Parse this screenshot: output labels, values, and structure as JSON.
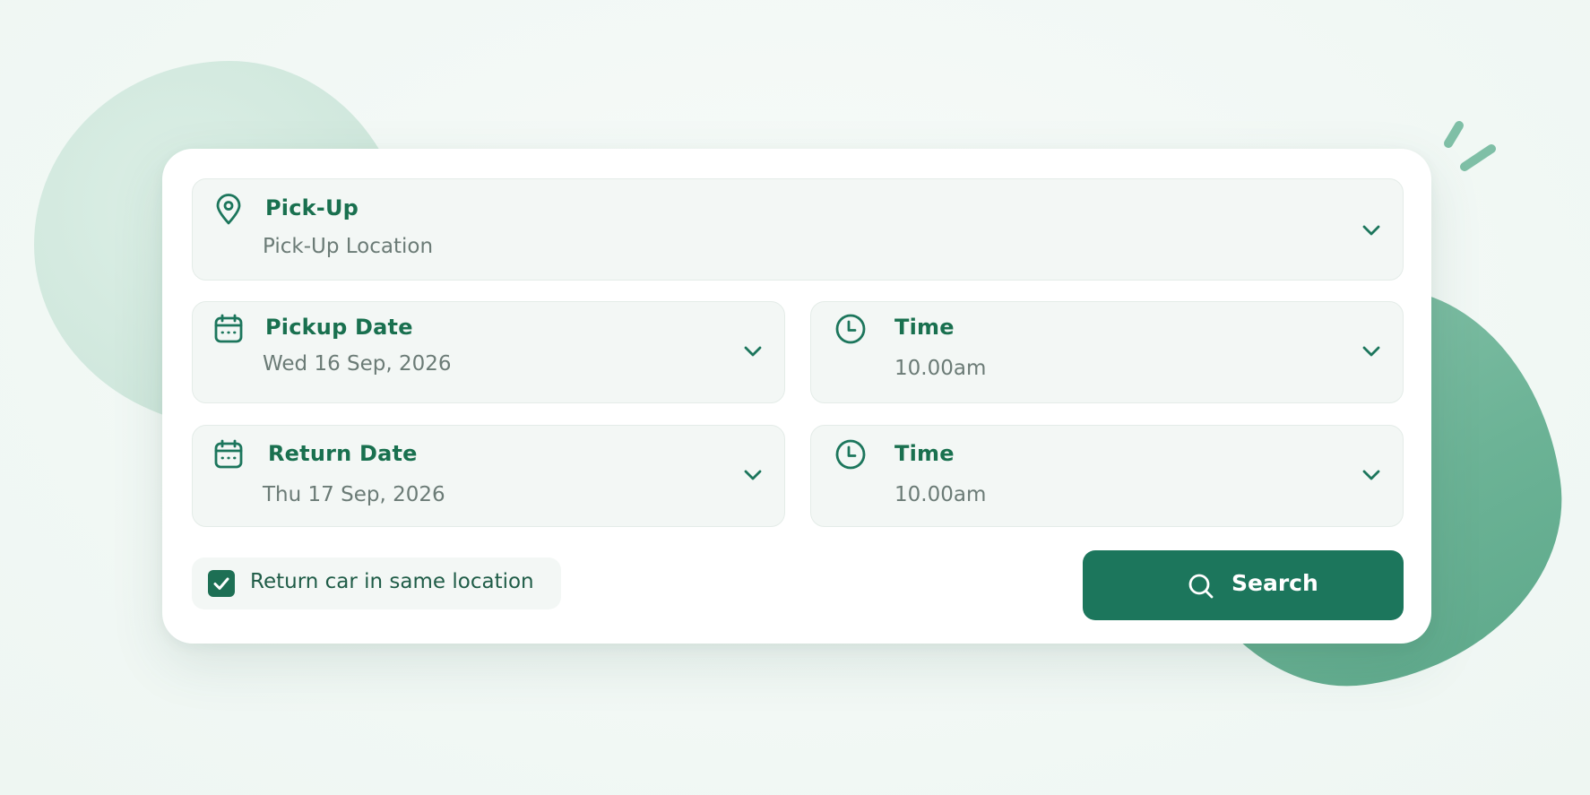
{
  "theme": {
    "primary": "#1c765c",
    "label_color": "#19704f",
    "field_bg": "#f3f7f5"
  },
  "pickup": {
    "label": "Pick-Up",
    "placeholder": "Pick-Up Location",
    "icon": "map-pin-icon"
  },
  "pickup_date": {
    "label": "Pickup Date",
    "value": "Wed 16 Sep, 2026",
    "icon": "calendar-icon"
  },
  "pickup_time": {
    "label": "Time",
    "value": "10.00am",
    "icon": "clock-icon"
  },
  "return_date": {
    "label": "Return Date",
    "value": "Thu 17 Sep, 2026",
    "icon": "calendar-icon"
  },
  "return_time": {
    "label": "Time",
    "value": "10.00am",
    "icon": "clock-icon"
  },
  "same_location": {
    "label": "Return car in same location",
    "checked": true
  },
  "search_button": {
    "label": "Search",
    "icon": "search-icon"
  }
}
